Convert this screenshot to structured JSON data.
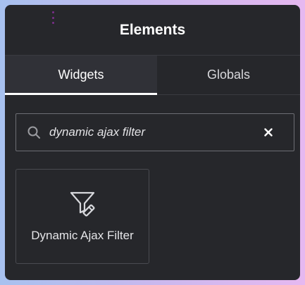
{
  "header": {
    "title": "Elements"
  },
  "tabs": [
    {
      "label": "Widgets",
      "active": true
    },
    {
      "label": "Globals",
      "active": false
    }
  ],
  "search": {
    "value": "dynamic ajax filter"
  },
  "widgets": [
    {
      "label": "Dynamic Ajax Filter",
      "icon": "filter-edit-icon"
    }
  ],
  "colors": {
    "panel_bg": "#26272b",
    "active_tab_bg": "#303137",
    "accent": "#ffffff",
    "handle": "#7b2f8a"
  }
}
